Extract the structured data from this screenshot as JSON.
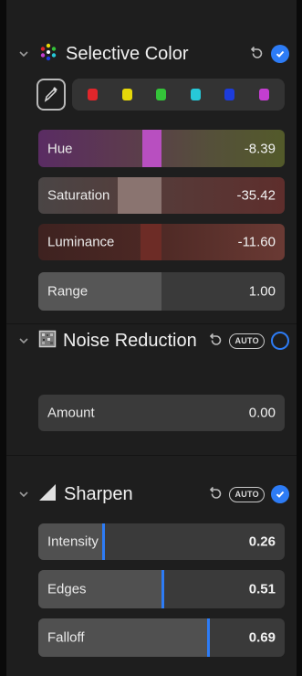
{
  "selective_color": {
    "title": "Selective Color",
    "swatches": [
      "#e0262b",
      "#e6d80a",
      "#34c339",
      "#27c8d8",
      "#1d3cdc",
      "#c33ed0"
    ],
    "sliders": {
      "hue": {
        "label": "Hue",
        "value": "-8.39"
      },
      "saturation": {
        "label": "Saturation",
        "value": "-35.42"
      },
      "luminance": {
        "label": "Luminance",
        "value": "-11.60"
      },
      "range": {
        "label": "Range",
        "value": "1.00"
      }
    }
  },
  "noise_reduction": {
    "title": "Noise Reduction",
    "auto_label": "AUTO",
    "amount": {
      "label": "Amount",
      "value": "0.00"
    }
  },
  "sharpen": {
    "title": "Sharpen",
    "auto_label": "AUTO",
    "intensity": {
      "label": "Intensity",
      "value": "0.26"
    },
    "edges": {
      "label": "Edges",
      "value": "0.51"
    },
    "falloff": {
      "label": "Falloff",
      "value": "0.69"
    }
  },
  "colors": {
    "accent": "#2d7cf6",
    "panel": "#1e1e1e",
    "slider": "#3a3a3a"
  }
}
